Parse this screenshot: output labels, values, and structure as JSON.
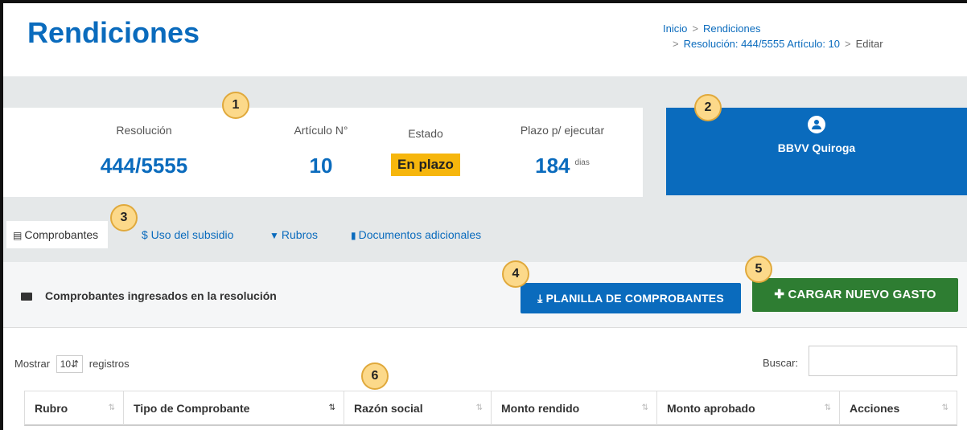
{
  "header": {
    "title": "Rendiciones",
    "breadcrumb": {
      "home": "Inicio",
      "sep": ">",
      "section": "Rendiciones",
      "resolution": "Resolución: 444/5555 Artículo: 10",
      "current": "Editar"
    }
  },
  "info": {
    "resolucion_label": "Resolución",
    "resolucion_value": "444/5555",
    "articulo_label": "Artículo N°",
    "articulo_value": "10",
    "estado_label": "Estado",
    "estado_value": "En plazo",
    "plazo_label": "Plazo p/ ejecutar",
    "plazo_value": "184",
    "plazo_unit": "dias"
  },
  "org": {
    "icon": "users-icon",
    "name": "BBVV Quiroga"
  },
  "tabs": [
    {
      "label": "Comprobantes",
      "icon": "receipt-icon"
    },
    {
      "label": "$ Uso del subsidio"
    },
    {
      "label": "Rubros",
      "icon": "filter-icon"
    },
    {
      "label": "Documentos adicionales",
      "icon": "file-icon"
    }
  ],
  "section": {
    "title": "Comprobantes ingresados en la resolución",
    "btn_planilla": "PLANILLA DE COMPROBANTES",
    "btn_cargar": "CARGAR NUEVO GASTO"
  },
  "table": {
    "mostrar": "Mostrar",
    "page_size": "10",
    "registros": "registros",
    "buscar": "Buscar:",
    "columns": [
      "Rubro",
      "Tipo de Comprobante",
      "Razón social",
      "Monto rendido",
      "Monto aprobado",
      "Acciones"
    ]
  },
  "callouts": [
    "1",
    "2",
    "3",
    "4",
    "5",
    "6"
  ],
  "colors": {
    "brand_blue": "#0a6bbd",
    "green": "#2e7d32",
    "badge_yellow": "#f6b60d",
    "callout": "#fcd98a"
  }
}
